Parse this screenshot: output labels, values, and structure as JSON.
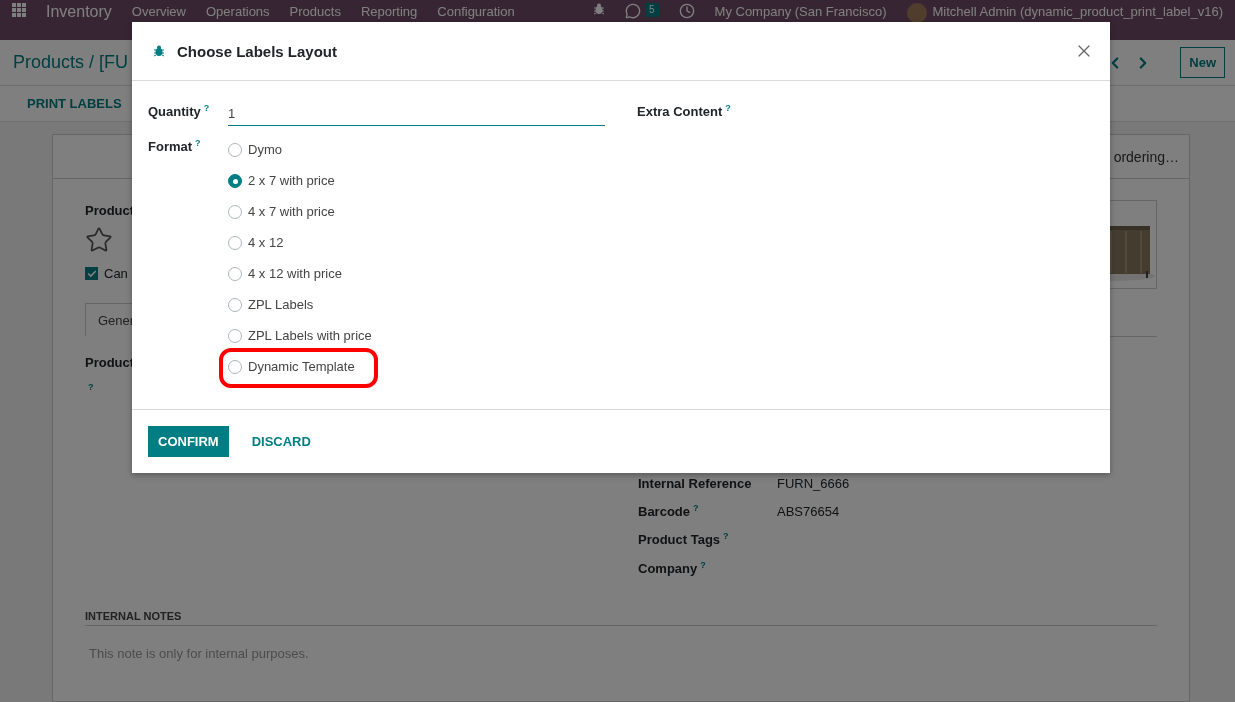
{
  "navbar": {
    "app": "Inventory",
    "menu": [
      "Overview",
      "Operations",
      "Products",
      "Reporting",
      "Configuration"
    ],
    "messages_count": "5",
    "company": "My Company (San Francisco)",
    "user": "Mitchell Admin (dynamic_product_print_label_v16)"
  },
  "breadcrumb": "Products / [FU",
  "new_button": "New",
  "action_button": "PRINT LABELS",
  "smart_button": "ordering…",
  "product": {
    "label": "Product",
    "can_label": "Can",
    "can_checked": true
  },
  "tabs": [
    {
      "label": "Gener",
      "selected": true
    }
  ],
  "left_field": {
    "label": "Product",
    "help": "?"
  },
  "right_fields": [
    {
      "label": "Internal Reference",
      "value": "FURN_6666"
    },
    {
      "label": "Barcode",
      "help": "?",
      "value": "ABS76654"
    },
    {
      "label": "Product Tags",
      "help": "?"
    },
    {
      "label": "Company",
      "help": "?"
    }
  ],
  "internal_notes": {
    "title": "INTERNAL NOTES",
    "placeholder": "This note is only for internal purposes."
  },
  "dialog": {
    "title": "Choose Labels Layout",
    "quantity": {
      "label": "Quantity",
      "help": "?",
      "value": "1"
    },
    "extra_content": {
      "label": "Extra Content",
      "help": "?"
    },
    "format": {
      "label": "Format",
      "help": "?",
      "options": [
        {
          "label": "Dymo",
          "selected": false,
          "highlighted": false
        },
        {
          "label": "2 x 7 with price",
          "selected": true,
          "highlighted": false
        },
        {
          "label": "4 x 7 with price",
          "selected": false,
          "highlighted": false
        },
        {
          "label": "4 x 12",
          "selected": false,
          "highlighted": false
        },
        {
          "label": "4 x 12 with price",
          "selected": false,
          "highlighted": false
        },
        {
          "label": "ZPL Labels",
          "selected": false,
          "highlighted": false
        },
        {
          "label": "ZPL Labels with price",
          "selected": false,
          "highlighted": false
        },
        {
          "label": "Dynamic Template",
          "selected": false,
          "highlighted": true
        }
      ]
    },
    "buttons": [
      {
        "label": "CONFIRM",
        "kind": "primary"
      },
      {
        "label": "DISCARD",
        "kind": "link"
      }
    ]
  }
}
